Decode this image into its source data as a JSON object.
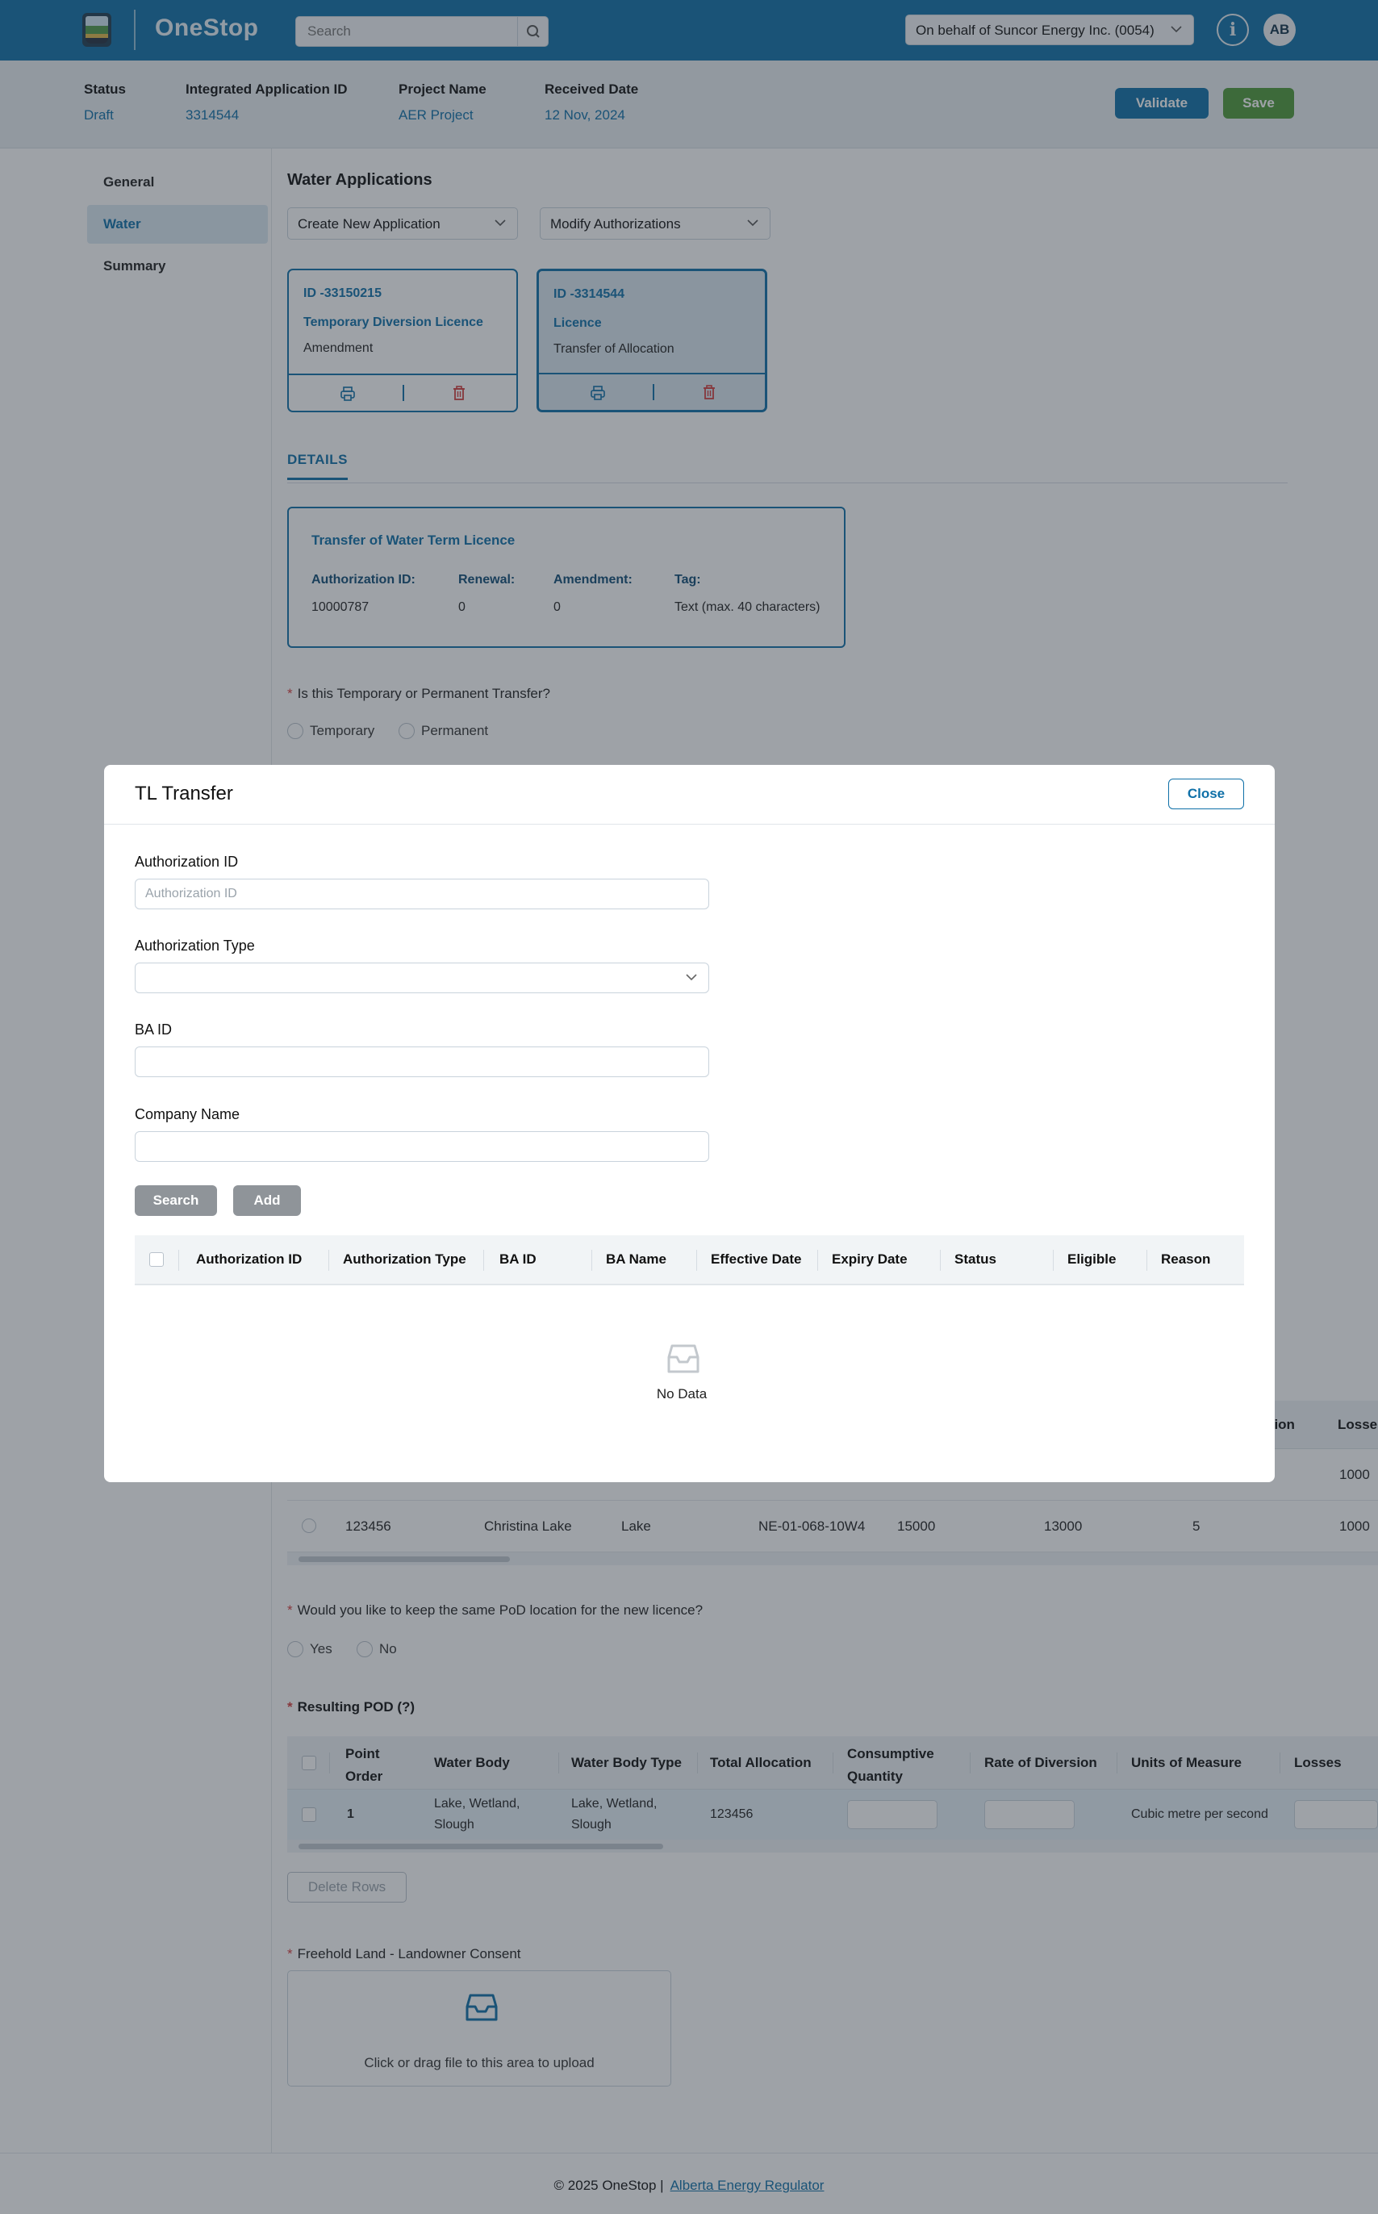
{
  "header": {
    "brand": "OneStop",
    "search_placeholder": "Search",
    "on_behalf": "On behalf of Suncor Energy Inc. (0054)",
    "info_label": "i",
    "avatar_initials": "AB"
  },
  "summary": {
    "status_label": "Status",
    "status_value": "Draft",
    "app_id_label": "Integrated Application ID",
    "app_id_value": "3314544",
    "project_label": "Project Name",
    "project_value": "AER Project",
    "received_label": "Received Date",
    "received_value": "12 Nov, 2024",
    "validate_label": "Validate",
    "save_label": "Save"
  },
  "sidebar": {
    "items": [
      {
        "label": "General"
      },
      {
        "label": "Water"
      },
      {
        "label": "Summary"
      }
    ]
  },
  "main": {
    "title": "Water Applications",
    "create_dropdown": "Create New Application",
    "modify_dropdown": "Modify Authorizations",
    "cards": [
      {
        "id": "ID -33150215",
        "type": "Temporary Diversion Licence",
        "sub": "Amendment"
      },
      {
        "id": "ID -3314544",
        "type": "Licence",
        "sub": "Transfer  of Allocation"
      }
    ],
    "details_tab": "DETAILS",
    "details": {
      "title": "Transfer of Water Term Licence",
      "auth_label": "Authorization ID:",
      "auth_value": "10000787",
      "renewal_label": "Renewal:",
      "renewal_value": "0",
      "amendment_label": "Amendment:",
      "amendment_value": "0",
      "tag_label": "Tag:",
      "tag_value": "Text (max. 40 characters)"
    },
    "q1": {
      "text": "Is this Temporary or Permanent Transfer?",
      "opt1": "Temporary",
      "opt2": "Permanent"
    },
    "lower_table": {
      "head_partial": [
        "sion",
        "Losses"
      ],
      "rows": [
        {
          "col1": "",
          "col2": "",
          "col3": "",
          "col4": "",
          "col5": "",
          "col6": "",
          "col7": "",
          "losses": "1000"
        },
        {
          "col1": "123456",
          "col2": "Christina Lake",
          "col3": "Lake",
          "col4": "NE-01-068-10W4",
          "col5": "15000",
          "col6": "13000",
          "col7": "5",
          "losses": "1000"
        }
      ]
    },
    "q2": {
      "text": "Would you like to keep the same PoD location for the new licence?",
      "opt1": "Yes",
      "opt2": "No"
    },
    "resulting_pod": {
      "title": "Resulting POD (?)",
      "headers": [
        "Point Order",
        "Water Body",
        "Water Body Type",
        "Total Allocation",
        "Consumptive Quantity",
        "Rate of Diversion",
        "Units of Measure",
        "Losses"
      ],
      "row": {
        "point_order": "1",
        "water_body": "Lake, Wetland, Slough",
        "water_body_type": "Lake, Wetland, Slough",
        "total_allocation": "123456",
        "units": "Cubic metre per second"
      }
    },
    "delete_rows": "Delete Rows",
    "consent": {
      "label": "Freehold Land - Landowner Consent",
      "upload_text": "Click or drag file to this area to upload"
    }
  },
  "modal": {
    "title": "TL Transfer",
    "close_label": "Close",
    "auth_id_label": "Authorization ID",
    "auth_id_placeholder": "Authorization ID",
    "auth_type_label": "Authorization Type",
    "ba_id_label": "BA ID",
    "company_label": "Company Name",
    "search_label": "Search",
    "add_label": "Add",
    "columns": [
      "Authorization ID",
      "Authorization Type",
      "BA ID",
      "BA Name",
      "Effective Date",
      "Expiry Date",
      "Status",
      "Eligible",
      "Reason"
    ],
    "empty_text": "No Data"
  },
  "footer": {
    "copyright": "© 2025 OneStop |",
    "link": "Alberta Energy Regulator"
  }
}
